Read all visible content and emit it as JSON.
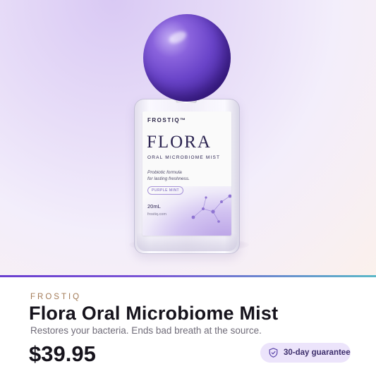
{
  "product_image": {
    "label": {
      "brand": "FROSTIQ™",
      "product_name": "FLORA",
      "subtitle": "ORAL MICROBIOME MIST",
      "tagline_line1": "Probiotic formula",
      "tagline_line2": "for lasting freshness.",
      "flavor": "PURPLE MINT",
      "volume": "20mL",
      "website": "frostiq.com"
    },
    "cap_color": "#6a44c9"
  },
  "accent_gradient": [
    "#6a3fd0",
    "#5bb8c8"
  ],
  "info": {
    "store_name": "FROSTIQ",
    "title": "Flora Oral Microbiome Mist",
    "description": "Restores your bacteria. Ends bad breath at the source.",
    "price": "$39.95",
    "guarantee_badge": {
      "icon": "shield-check-icon",
      "label": "30-day guarantee",
      "background": "#ece4fb"
    }
  }
}
